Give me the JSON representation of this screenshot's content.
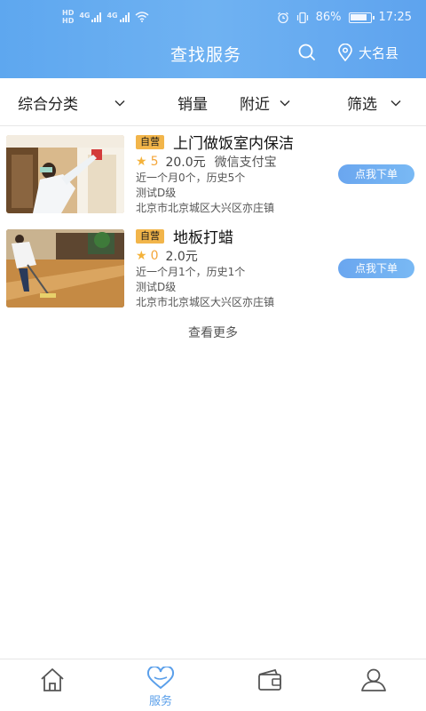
{
  "status_bar": {
    "hd1": "HD",
    "hd2": "HD",
    "net1": "4G",
    "net2": "4G",
    "battery_text": "86%",
    "battery_level": 0.86,
    "time": "17:25"
  },
  "header": {
    "title": "查找服务",
    "search_icon": "search-icon",
    "location_icon": "location-pin-icon",
    "location": "大名县"
  },
  "filters": {
    "category": "综合分类",
    "sales": "销量",
    "nearby": "附近",
    "screen": "筛选"
  },
  "services": [
    {
      "tag": "自营",
      "name": "上门做饭室内保洁",
      "rating": "5",
      "price": "20.0元",
      "payment": "微信支付宝",
      "history": "近一个月0个，历史5个",
      "level": "测试D级",
      "address": "北京市北京城区大兴区亦庄镇",
      "order_label": "点我下单"
    },
    {
      "tag": "自营",
      "name": "地板打蜡",
      "rating": "0",
      "price": "2.0元",
      "payment": "",
      "history": "近一个月1个，历史1个",
      "level": "测试D级",
      "address": "北京市北京城区大兴区亦庄镇",
      "order_label": "点我下单"
    }
  ],
  "more_label": "查看更多",
  "bottom_nav": [
    {
      "icon": "home-icon",
      "label": ""
    },
    {
      "icon": "heart-icon",
      "label": "服务"
    },
    {
      "icon": "wallet-icon",
      "label": ""
    },
    {
      "icon": "user-icon",
      "label": ""
    }
  ],
  "colors": {
    "header": "#6fb2f2",
    "accent": "#5a9fea",
    "tag": "#f2b54a",
    "star": "#f4b23a"
  }
}
